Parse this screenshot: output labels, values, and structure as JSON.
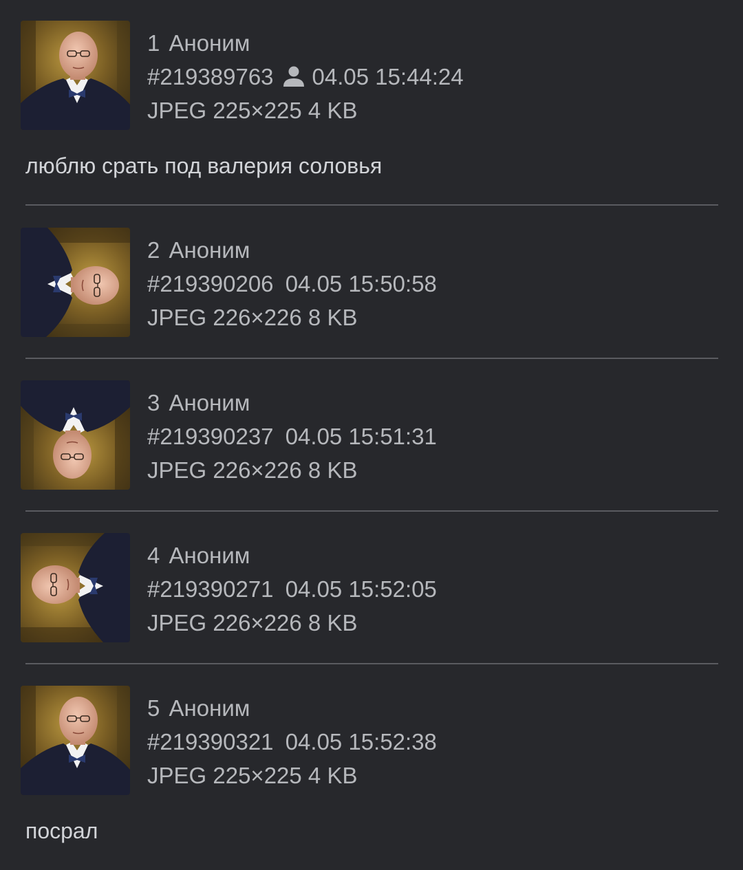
{
  "posts": [
    {
      "number": "1",
      "author": "Аноним",
      "id": "#219389763",
      "is_op": true,
      "datetime": "04.05 15:44:24",
      "file": "JPEG 225×225 4 KB",
      "comment": "люблю срать под валерия соловья"
    },
    {
      "number": "2",
      "author": "Аноним",
      "id": "#219390206",
      "is_op": false,
      "datetime": "04.05 15:50:58",
      "file": "JPEG 226×226 8 KB",
      "comment": ""
    },
    {
      "number": "3",
      "author": "Аноним",
      "id": "#219390237",
      "is_op": false,
      "datetime": "04.05 15:51:31",
      "file": "JPEG 226×226 8 KB",
      "comment": ""
    },
    {
      "number": "4",
      "author": "Аноним",
      "id": "#219390271",
      "is_op": false,
      "datetime": "04.05 15:52:05",
      "file": "JPEG 226×226 8 KB",
      "comment": ""
    },
    {
      "number": "5",
      "author": "Аноним",
      "id": "#219390321",
      "is_op": false,
      "datetime": "04.05 15:52:38",
      "file": "JPEG 225×225 4 KB",
      "comment": "посрал"
    }
  ],
  "icons": {
    "op_marker": "person-icon"
  },
  "colors": {
    "background": "#27282c",
    "meta_text": "#b6b8bc",
    "comment_text": "#d2d4d8",
    "divider": "#5a5b60"
  }
}
